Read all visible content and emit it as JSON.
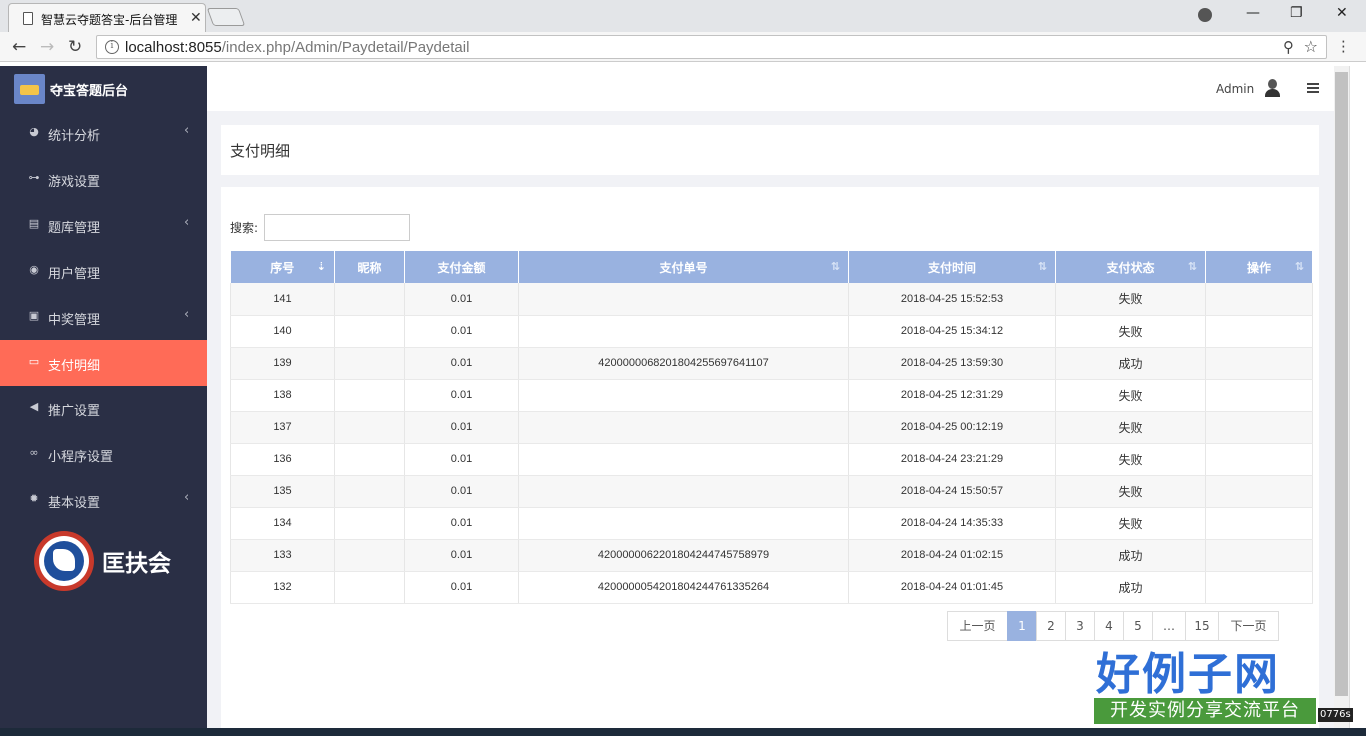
{
  "browser": {
    "tab_title": "智慧云夺题答宝-后台管理",
    "url_host": "localhost:8055",
    "url_path": "/index.php/Admin/Paydetail/Paydetail"
  },
  "sidebar": {
    "brand": "夺宝答题后台",
    "items": [
      {
        "label": "统计分析",
        "icon": "pie-chart-icon",
        "has_sub": true
      },
      {
        "label": "游戏设置",
        "icon": "gamepad-icon",
        "has_sub": false
      },
      {
        "label": "题库管理",
        "icon": "list-icon",
        "has_sub": true
      },
      {
        "label": "用户管理",
        "icon": "user-icon",
        "has_sub": false
      },
      {
        "label": "中奖管理",
        "icon": "gift-icon",
        "has_sub": true
      },
      {
        "label": "支付明细",
        "icon": "credit-card-icon",
        "has_sub": false,
        "active": true
      },
      {
        "label": "推广设置",
        "icon": "bullhorn-icon",
        "has_sub": false
      },
      {
        "label": "小程序设置",
        "icon": "link-icon",
        "has_sub": false
      },
      {
        "label": "基本设置",
        "icon": "gear-icon",
        "has_sub": true
      }
    ],
    "org_name": "匡扶会"
  },
  "header": {
    "admin_name": "Admin"
  },
  "page": {
    "title": "支付明细",
    "search_label": "搜索:",
    "search_value": ""
  },
  "table": {
    "columns": [
      "序号",
      "昵称",
      "支付金额",
      "支付单号",
      "支付时间",
      "支付状态",
      "操作"
    ],
    "rows": [
      {
        "id": "141",
        "nickname": "",
        "amount": "0.01",
        "order_no": "",
        "time": "2018-04-25 15:52:53",
        "status": "失败",
        "action": ""
      },
      {
        "id": "140",
        "nickname": "",
        "amount": "0.01",
        "order_no": "",
        "time": "2018-04-25 15:34:12",
        "status": "失败",
        "action": ""
      },
      {
        "id": "139",
        "nickname": "",
        "amount": "0.01",
        "order_no": "4200000068201804255697641107",
        "time": "2018-04-25 13:59:30",
        "status": "成功",
        "action": ""
      },
      {
        "id": "138",
        "nickname": "",
        "amount": "0.01",
        "order_no": "",
        "time": "2018-04-25 12:31:29",
        "status": "失败",
        "action": ""
      },
      {
        "id": "137",
        "nickname": "",
        "amount": "0.01",
        "order_no": "",
        "time": "2018-04-25 00:12:19",
        "status": "失败",
        "action": ""
      },
      {
        "id": "136",
        "nickname": "",
        "amount": "0.01",
        "order_no": "",
        "time": "2018-04-24 23:21:29",
        "status": "失败",
        "action": ""
      },
      {
        "id": "135",
        "nickname": "",
        "amount": "0.01",
        "order_no": "",
        "time": "2018-04-24 15:50:57",
        "status": "失败",
        "action": ""
      },
      {
        "id": "134",
        "nickname": "",
        "amount": "0.01",
        "order_no": "",
        "time": "2018-04-24 14:35:33",
        "status": "失败",
        "action": ""
      },
      {
        "id": "133",
        "nickname": "",
        "amount": "0.01",
        "order_no": "4200000062201804244745758979",
        "time": "2018-04-24 01:02:15",
        "status": "成功",
        "action": ""
      },
      {
        "id": "132",
        "nickname": "",
        "amount": "0.01",
        "order_no": "4200000054201804244761335264",
        "time": "2018-04-24 01:01:45",
        "status": "成功",
        "action": ""
      }
    ]
  },
  "pagination": {
    "prev": "上一页",
    "pages": [
      "1",
      "2",
      "3",
      "4",
      "5",
      "…",
      "15"
    ],
    "current": "1",
    "next": "下一页"
  },
  "overlay": {
    "watermark_title": "好例子网",
    "watermark_sub": "开发实例分享交流平台",
    "corner_text": "0776s"
  },
  "colors": {
    "sidebar_bg": "#2a2f45",
    "active_item": "#ff6b57",
    "table_header": "#99b2e0"
  }
}
